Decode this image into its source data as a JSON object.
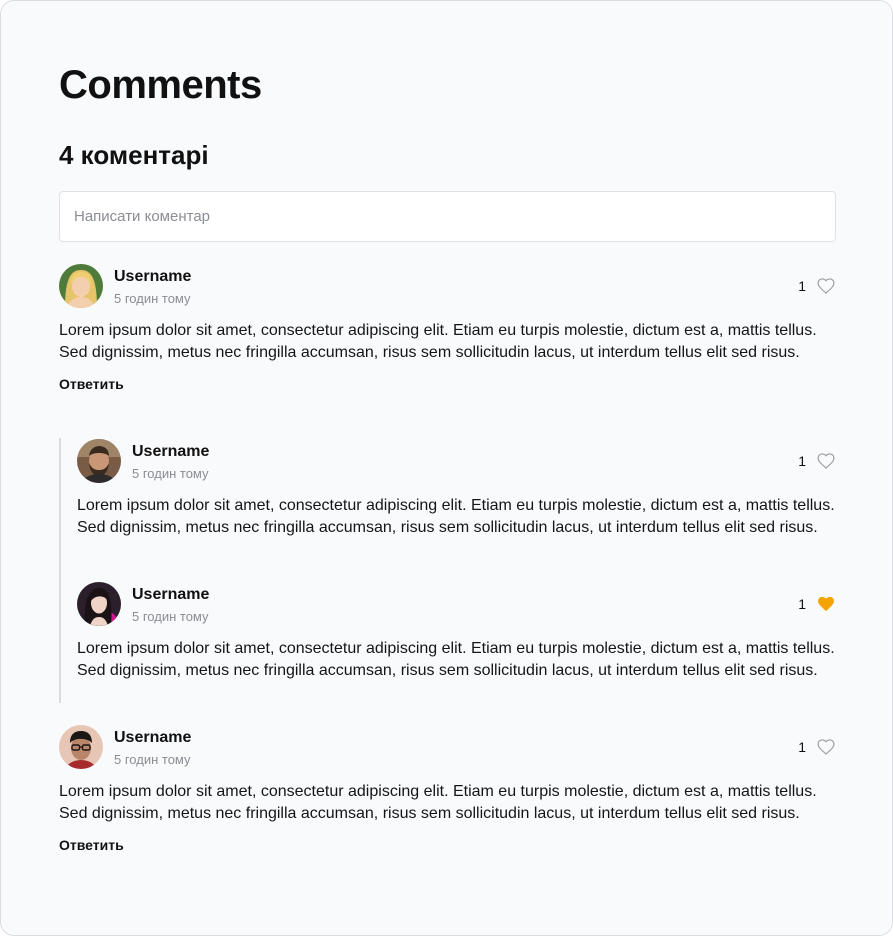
{
  "page": {
    "title": "Comments",
    "count_label": "4 коментарі"
  },
  "input": {
    "placeholder": "Написати коментар"
  },
  "colors": {
    "liked_heart": "#f5a300",
    "heart_outline": "#9a9ca1",
    "thread_line": "#d9dbe0"
  },
  "comments": [
    {
      "username": "Username",
      "time": "5 годин тому",
      "likes": "1",
      "liked": false,
      "text": "Lorem ipsum dolor sit amet, consectetur adipiscing elit. Etiam eu turpis molestie, dictum est a, mattis tellus. Sed dignissim, metus nec fringilla accumsan, risus sem sollicitudin lacus, ut interdum tellus elit sed risus.",
      "reply_label": "Ответить",
      "avatar_icon": "avatar-blonde-woman"
    },
    {
      "username": "Username",
      "time": "5 годин тому",
      "likes": "1",
      "liked": false,
      "text": "Lorem ipsum dolor sit amet, consectetur adipiscing elit. Etiam eu turpis molestie, dictum est a, mattis tellus. Sed dignissim, metus nec fringilla accumsan, risus sem sollicitudin lacus, ut interdum tellus elit sed risus.",
      "avatar_icon": "avatar-bearded-man"
    },
    {
      "username": "Username",
      "time": "5 годин тому",
      "likes": "1",
      "liked": true,
      "text": "Lorem ipsum dolor sit amet, consectetur adipiscing elit. Etiam eu turpis molestie, dictum est a, mattis tellus. Sed dignissim, metus nec fringilla accumsan, risus sem sollicitudin lacus, ut interdum tellus elit sed risus.",
      "avatar_icon": "avatar-dark-haired-woman"
    },
    {
      "username": "Username",
      "time": "5 годин тому",
      "likes": "1",
      "liked": false,
      "text": "Lorem ipsum dolor sit amet, consectetur adipiscing elit. Etiam eu turpis molestie, dictum est a, mattis tellus. Sed dignissim, metus nec fringilla accumsan, risus sem sollicitudin lacus, ut interdum tellus elit sed risus.",
      "reply_label": "Ответить",
      "avatar_icon": "avatar-man-glasses"
    }
  ]
}
